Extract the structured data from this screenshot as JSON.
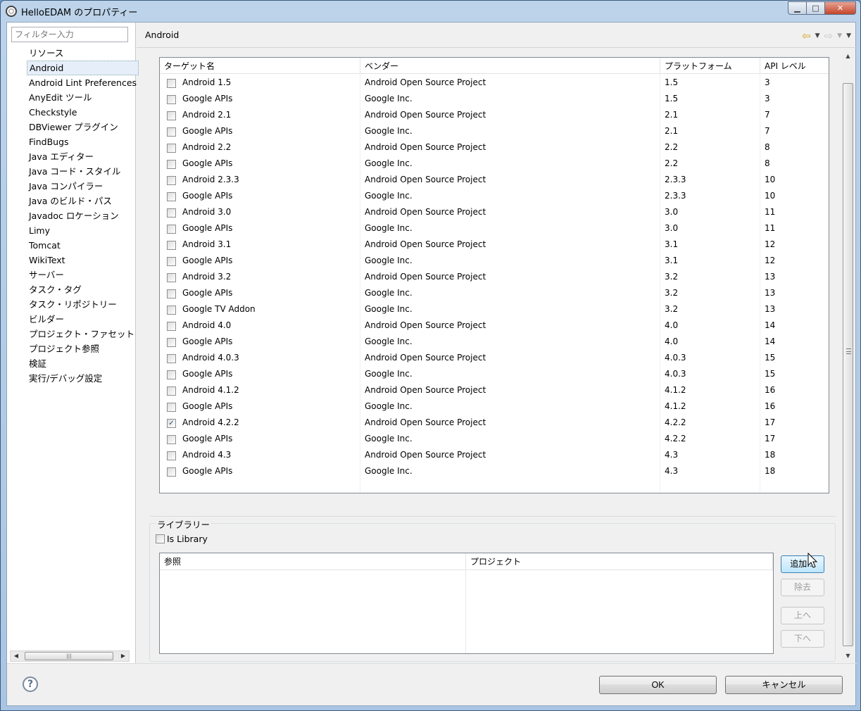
{
  "window": {
    "title": "HelloEDAM のプロパティー",
    "min_label": "▁",
    "max_label": "□",
    "close_label": "✕"
  },
  "sidebar": {
    "filter_placeholder": "フィルター入力",
    "items": [
      {
        "label": "リソース"
      },
      {
        "label": "Android",
        "selected": true
      },
      {
        "label": "Android Lint Preferences"
      },
      {
        "label": "AnyEdit ツール"
      },
      {
        "label": "Checkstyle"
      },
      {
        "label": "DBViewer プラグイン"
      },
      {
        "label": "FindBugs"
      },
      {
        "label": "Java エディター"
      },
      {
        "label": "Java コード・スタイル"
      },
      {
        "label": "Java コンパイラー"
      },
      {
        "label": "Java のビルド・パス"
      },
      {
        "label": "Javadoc ロケーション"
      },
      {
        "label": "Limy"
      },
      {
        "label": "Tomcat"
      },
      {
        "label": "WikiText"
      },
      {
        "label": "サーバー"
      },
      {
        "label": "タスク・タグ"
      },
      {
        "label": "タスク・リポジトリー"
      },
      {
        "label": "ビルダー"
      },
      {
        "label": "プロジェクト・ファセット"
      },
      {
        "label": "プロジェクト参照"
      },
      {
        "label": "検証"
      },
      {
        "label": "実行/デバッグ設定"
      }
    ]
  },
  "page": {
    "title": "Android",
    "back_icon": "back-arrow-icon",
    "forward_icon": "forward-arrow-icon"
  },
  "targets": {
    "headers": [
      "ターゲット名",
      "ベンダー",
      "プラットフォーム",
      "API レベル"
    ],
    "rows": [
      {
        "name": "Android 1.5",
        "vendor": "Android Open Source Project",
        "platform": "1.5",
        "api": "3",
        "checked": false
      },
      {
        "name": "Google APIs",
        "vendor": "Google Inc.",
        "platform": "1.5",
        "api": "3",
        "checked": false
      },
      {
        "name": "Android 2.1",
        "vendor": "Android Open Source Project",
        "platform": "2.1",
        "api": "7",
        "checked": false
      },
      {
        "name": "Google APIs",
        "vendor": "Google Inc.",
        "platform": "2.1",
        "api": "7",
        "checked": false
      },
      {
        "name": "Android 2.2",
        "vendor": "Android Open Source Project",
        "platform": "2.2",
        "api": "8",
        "checked": false
      },
      {
        "name": "Google APIs",
        "vendor": "Google Inc.",
        "platform": "2.2",
        "api": "8",
        "checked": false
      },
      {
        "name": "Android 2.3.3",
        "vendor": "Android Open Source Project",
        "platform": "2.3.3",
        "api": "10",
        "checked": false
      },
      {
        "name": "Google APIs",
        "vendor": "Google Inc.",
        "platform": "2.3.3",
        "api": "10",
        "checked": false
      },
      {
        "name": "Android 3.0",
        "vendor": "Android Open Source Project",
        "platform": "3.0",
        "api": "11",
        "checked": false
      },
      {
        "name": "Google APIs",
        "vendor": "Google Inc.",
        "platform": "3.0",
        "api": "11",
        "checked": false
      },
      {
        "name": "Android 3.1",
        "vendor": "Android Open Source Project",
        "platform": "3.1",
        "api": "12",
        "checked": false
      },
      {
        "name": "Google APIs",
        "vendor": "Google Inc.",
        "platform": "3.1",
        "api": "12",
        "checked": false
      },
      {
        "name": "Android 3.2",
        "vendor": "Android Open Source Project",
        "platform": "3.2",
        "api": "13",
        "checked": false
      },
      {
        "name": "Google APIs",
        "vendor": "Google Inc.",
        "platform": "3.2",
        "api": "13",
        "checked": false
      },
      {
        "name": "Google TV Addon",
        "vendor": "Google Inc.",
        "platform": "3.2",
        "api": "13",
        "checked": false
      },
      {
        "name": "Android 4.0",
        "vendor": "Android Open Source Project",
        "platform": "4.0",
        "api": "14",
        "checked": false
      },
      {
        "name": "Google APIs",
        "vendor": "Google Inc.",
        "platform": "4.0",
        "api": "14",
        "checked": false
      },
      {
        "name": "Android 4.0.3",
        "vendor": "Android Open Source Project",
        "platform": "4.0.3",
        "api": "15",
        "checked": false
      },
      {
        "name": "Google APIs",
        "vendor": "Google Inc.",
        "platform": "4.0.3",
        "api": "15",
        "checked": false
      },
      {
        "name": "Android 4.1.2",
        "vendor": "Android Open Source Project",
        "platform": "4.1.2",
        "api": "16",
        "checked": false
      },
      {
        "name": "Google APIs",
        "vendor": "Google Inc.",
        "platform": "4.1.2",
        "api": "16",
        "checked": false
      },
      {
        "name": "Android 4.2.2",
        "vendor": "Android Open Source Project",
        "platform": "4.2.2",
        "api": "17",
        "checked": true
      },
      {
        "name": "Google APIs",
        "vendor": "Google Inc.",
        "platform": "4.2.2",
        "api": "17",
        "checked": false
      },
      {
        "name": "Android 4.3",
        "vendor": "Android Open Source Project",
        "platform": "4.3",
        "api": "18",
        "checked": false
      },
      {
        "name": "Google APIs",
        "vendor": "Google Inc.",
        "platform": "4.3",
        "api": "18",
        "checked": false
      }
    ]
  },
  "library": {
    "group_label": "ライブラリー",
    "is_library_label": "Is Library",
    "is_library_checked": false,
    "headers": [
      "参照",
      "プロジェクト"
    ],
    "add_label": "追加...",
    "remove_label": "除去",
    "up_label": "上へ",
    "down_label": "下へ"
  },
  "footer": {
    "help_label": "?",
    "ok_label": "OK",
    "cancel_label": "キャンセル"
  },
  "colors": {
    "accent": "#3c7fb1",
    "selection": "#e5eef9"
  }
}
